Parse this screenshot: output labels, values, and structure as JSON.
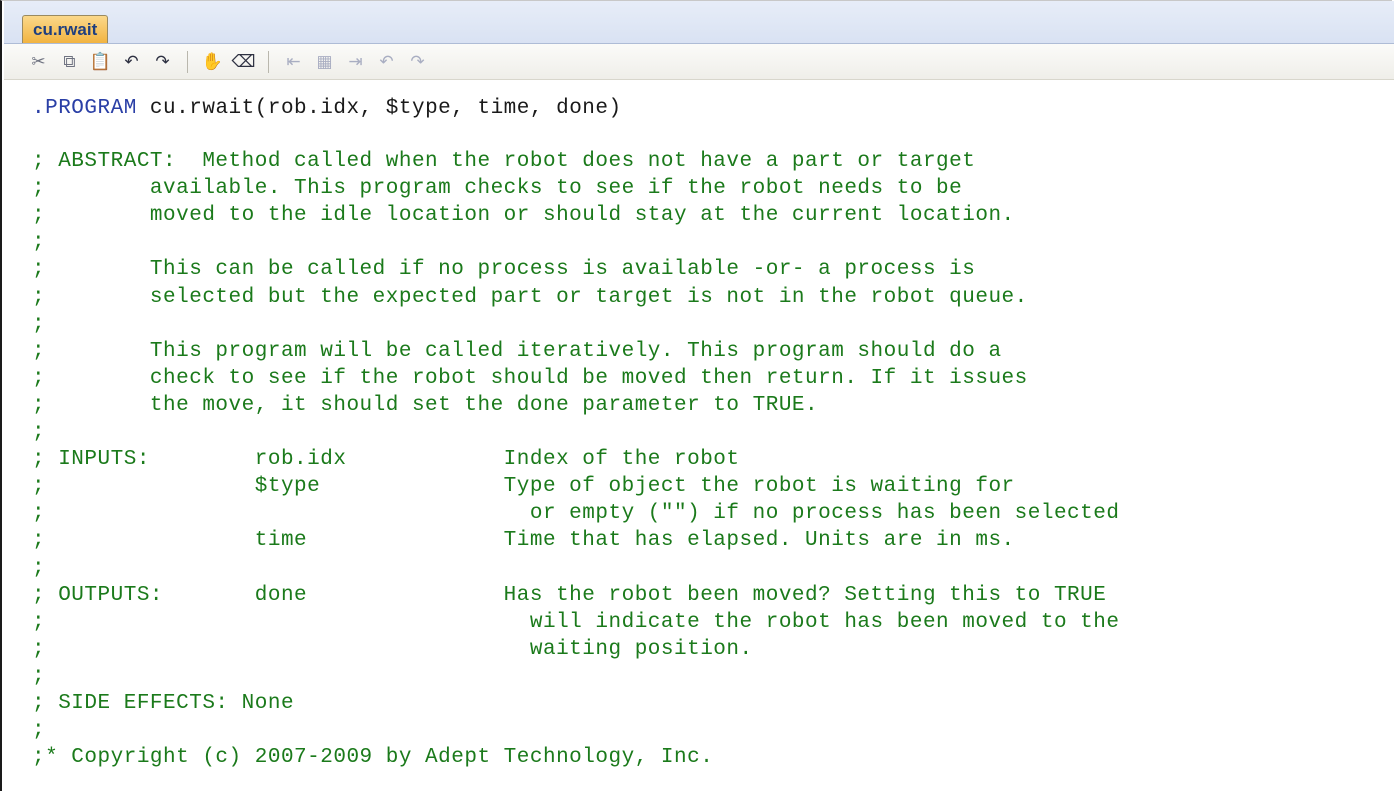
{
  "tab": {
    "label": "cu.rwait"
  },
  "toolbar": {
    "buttons": [
      {
        "name": "cut-icon",
        "glyph": "✂"
      },
      {
        "name": "copy-icon",
        "glyph": "⧉"
      },
      {
        "name": "paste-icon",
        "glyph": "📋"
      },
      {
        "name": "undo-icon",
        "glyph": "↶"
      },
      {
        "name": "redo-icon",
        "glyph": "↷"
      },
      {
        "name": "hand-icon",
        "glyph": "✋"
      },
      {
        "name": "eraser-icon",
        "glyph": "⌫"
      },
      {
        "name": "indent-icon",
        "glyph": "⇤"
      },
      {
        "name": "call-icon",
        "glyph": "▦"
      },
      {
        "name": "goto-icon",
        "glyph": "⇥"
      },
      {
        "name": "undo-disabled-icon",
        "glyph": "↶"
      },
      {
        "name": "redo-disabled-icon",
        "glyph": "↷"
      }
    ]
  },
  "code": {
    "program_keyword": ".PROGRAM",
    "program_signature": " cu.rwait(rob.idx, $type, time, done)",
    "comment_lines": [
      "; ABSTRACT:  Method called when the robot does not have a part or target",
      ";        available. This program checks to see if the robot needs to be",
      ";        moved to the idle location or should stay at the current location.",
      ";",
      ";        This can be called if no process is available -or- a process is",
      ";        selected but the expected part or target is not in the robot queue.",
      ";",
      ";        This program will be called iteratively. This program should do a",
      ";        check to see if the robot should be moved then return. If it issues",
      ";        the move, it should set the done parameter to TRUE.",
      ";",
      "; INPUTS:        rob.idx            Index of the robot",
      ";                $type              Type of object the robot is waiting for",
      ";                                     or empty (\"\") if no process has been selected",
      ";                time               Time that has elapsed. Units are in ms.",
      ";",
      "; OUTPUTS:       done               Has the robot been moved? Setting this to TRUE",
      ";                                     will indicate the robot has been moved to the",
      ";                                     waiting position.",
      ";",
      "; SIDE EFFECTS: None",
      ";",
      ";* Copyright (c) 2007-2009 by Adept Technology, Inc."
    ]
  }
}
